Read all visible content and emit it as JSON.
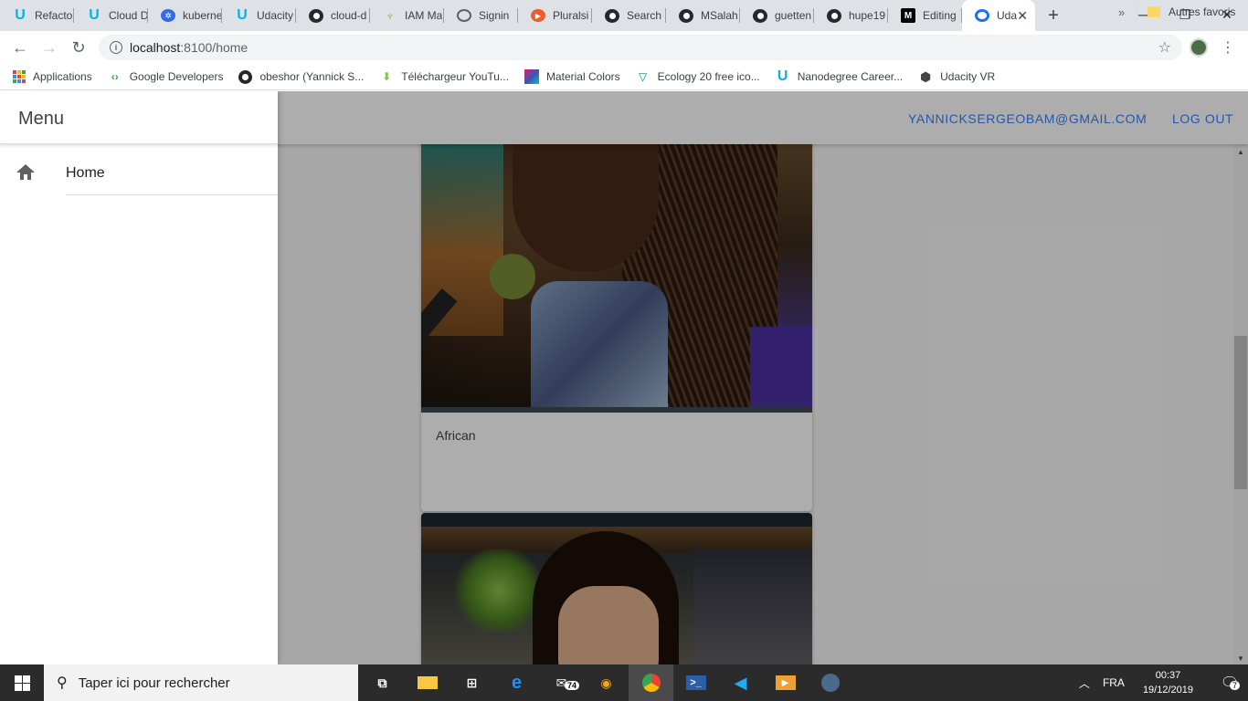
{
  "browser": {
    "tabs": [
      {
        "label": "Refacto",
        "icon": "udacity-icon"
      },
      {
        "label": "Cloud D",
        "icon": "udacity-icon"
      },
      {
        "label": "kuberne",
        "icon": "kubernetes-icon"
      },
      {
        "label": "Udacity",
        "icon": "udacity-icon"
      },
      {
        "label": "cloud-d",
        "icon": "github-icon"
      },
      {
        "label": "IAM Ma",
        "icon": "iam-icon"
      },
      {
        "label": "Signin",
        "icon": "globe-icon"
      },
      {
        "label": "Pluralsi",
        "icon": "pluralsight-icon"
      },
      {
        "label": "Search",
        "icon": "github-icon"
      },
      {
        "label": "MSalah",
        "icon": "github-icon"
      },
      {
        "label": "guetten",
        "icon": "github-icon"
      },
      {
        "label": "hupe19",
        "icon": "github-icon"
      },
      {
        "label": "Editing",
        "icon": "medium-icon"
      },
      {
        "label": "Uda",
        "icon": "loading-icon",
        "active": true
      }
    ],
    "address": {
      "host": "localhost",
      "path": ":8100/home"
    },
    "bookmarks": [
      {
        "label": "Applications",
        "icon": "apps-grid-icon"
      },
      {
        "label": "Google Developers",
        "icon": "google-developers-icon"
      },
      {
        "label": "obeshor (Yannick S...",
        "icon": "github-icon"
      },
      {
        "label": "Téléchargeur YouTu...",
        "icon": "download-icon"
      },
      {
        "label": "Material Colors",
        "icon": "material-colors-icon"
      },
      {
        "label": "Ecology 20 free ico...",
        "icon": "ecology-icon"
      },
      {
        "label": "Nanodegree Career...",
        "icon": "udacity-icon"
      },
      {
        "label": "Udacity VR",
        "icon": "vr-cube-icon"
      }
    ],
    "bookmarks_more": "»",
    "other_bookmarks": "Autres favoris"
  },
  "app": {
    "user_email": "YANNICKSERGEOBAM@GMAIL.COM",
    "logout_label": "LOG OUT",
    "menu": {
      "title": "Menu",
      "items": [
        {
          "label": "Home",
          "icon": "home-icon"
        }
      ]
    },
    "feed": [
      {
        "caption": "African"
      },
      {
        "caption": ""
      }
    ],
    "accent_color": "#3880ff"
  },
  "taskbar": {
    "search_placeholder": "Taper ici pour rechercher",
    "mail_badge": "74",
    "language": "FRA",
    "time": "00:37",
    "date": "19/12/2019",
    "notifications": "7"
  }
}
